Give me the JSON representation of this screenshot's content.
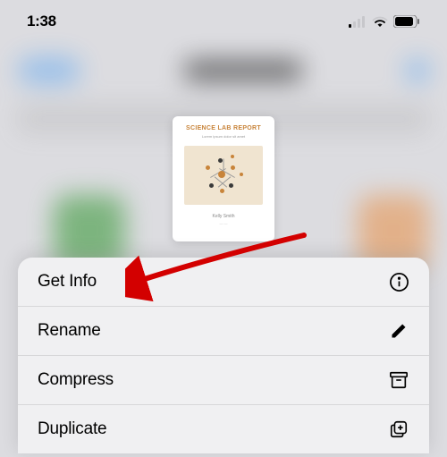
{
  "status_bar": {
    "time": "1:38"
  },
  "document": {
    "title": "SCIENCE LAB REPORT",
    "subtitle_placeholder": "Lorem ipsum dolor sit amet",
    "author": "Kelly Smith",
    "footer_line": "— —"
  },
  "menu": {
    "items": [
      {
        "label": "Get Info",
        "icon": "info-circle-icon"
      },
      {
        "label": "Rename",
        "icon": "pencil-icon"
      },
      {
        "label": "Compress",
        "icon": "archivebox-icon"
      },
      {
        "label": "Duplicate",
        "icon": "plus-on-square-icon"
      }
    ]
  }
}
